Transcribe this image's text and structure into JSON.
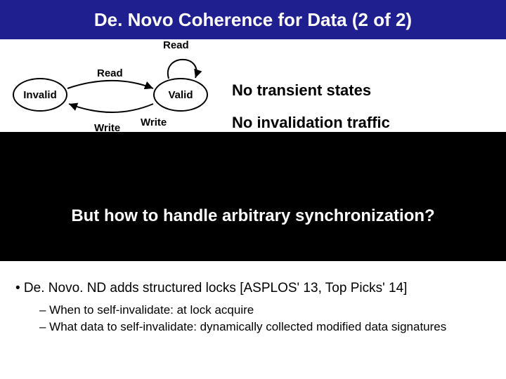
{
  "title": "De. Novo Coherence for Data (2 of 2)",
  "diagram": {
    "state_invalid": "Invalid",
    "state_valid": "Valid",
    "label_read_self": "Read",
    "label_read_top": "Read",
    "label_write_mid": "Write",
    "label_write_bot": "Write"
  },
  "annotations": {
    "line1": "No transient states",
    "line2": "No invalidation traffic"
  },
  "question": "But how to handle arbitrary synchronization?",
  "bullets": {
    "main": "•  De. Novo. ND adds structured locks [ASPLOS' 13, Top Picks' 14]",
    "sub1": "– When to self-invalidate: at lock acquire",
    "sub2": "– What data to self-invalidate: dynamically collected modified data signatures"
  }
}
